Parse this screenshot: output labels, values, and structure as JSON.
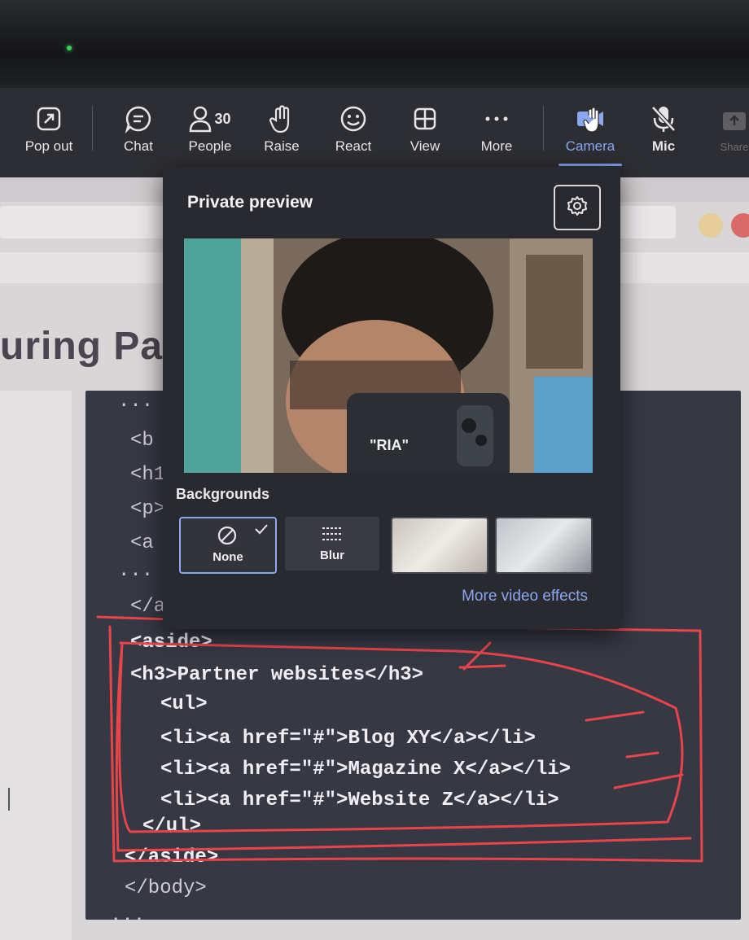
{
  "toolbar": {
    "items": [
      {
        "label": "Pop out",
        "icon": "popout-icon"
      },
      {
        "label": "Chat",
        "icon": "chat-icon"
      },
      {
        "label": "People",
        "icon": "people-icon",
        "count": "30"
      },
      {
        "label": "Raise",
        "icon": "raise-hand-icon"
      },
      {
        "label": "React",
        "icon": "react-smile-icon"
      },
      {
        "label": "View",
        "icon": "view-grid-icon"
      },
      {
        "label": "More",
        "icon": "more-dots-icon"
      },
      {
        "label": "Camera",
        "icon": "camera-off-icon",
        "active": true
      },
      {
        "label": "Mic",
        "icon": "mic-off-icon"
      },
      {
        "label": "Share",
        "icon": "share-icon"
      }
    ]
  },
  "page": {
    "heading": "uring Pa",
    "code_lines": [
      "...",
      "<b",
      "<h1",
      "<p>",
      "<a",
      "...",
      "</a",
      "<aside>",
      "<h3>Partner websites</h3>",
      "<ul>",
      "<li><a href=\"#\">Blog XY</a></li>",
      "<li><a href=\"#\">Magazine X</a></li>",
      "<li><a href=\"#\">Website Z</a></li>",
      "</ul>",
      "</aside>",
      "</body>",
      "..."
    ]
  },
  "popup": {
    "title": "Private preview",
    "phone_text": "\"RIA\"",
    "backgrounds_label": "Backgrounds",
    "options": [
      {
        "label": "None",
        "selected": true
      },
      {
        "label": "Blur"
      },
      {
        "label": ""
      },
      {
        "label": ""
      }
    ],
    "more_effects": "More video effects"
  },
  "colors": {
    "accent": "#8aa7f0",
    "toolbar_bg": "#2d2e33",
    "code_bg": "#363844",
    "annotation_red": "#e8454a"
  }
}
